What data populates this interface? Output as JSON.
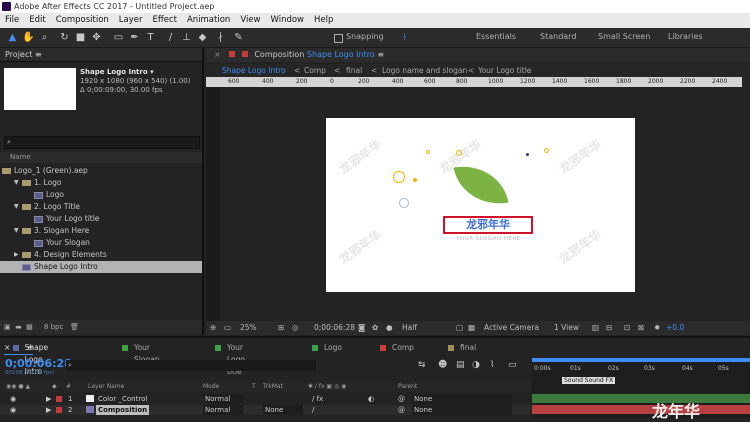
{
  "window": {
    "title": "Adobe After Effects CC 2017 - Untitled Project.aep"
  },
  "menu": [
    "File",
    "Edit",
    "Composition",
    "Layer",
    "Effect",
    "Animation",
    "View",
    "Window",
    "Help"
  ],
  "toolbar": {
    "snapping": "Snapping",
    "workspaces": [
      "Essentials",
      "Standard",
      "Small Screen",
      "Libraries"
    ]
  },
  "project": {
    "panel_title": "Project",
    "item_name": "Shape Logo Intro",
    "item_info1": "1920 x 1080  (960 x 540) (1.00)",
    "item_info2": "Δ 0;00:09:00, 30.00 fps",
    "col_name": "Name",
    "tree": [
      {
        "label": "Logo_1 (Green).aep",
        "indent": 0,
        "kind": "folder",
        "arrow": "▼"
      },
      {
        "label": "1. Logo",
        "indent": 1,
        "kind": "folder",
        "arrow": "▼"
      },
      {
        "label": "Logo",
        "indent": 2,
        "kind": "comp",
        "arrow": ""
      },
      {
        "label": "2. Logo Title",
        "indent": 1,
        "kind": "folder",
        "arrow": "▼"
      },
      {
        "label": "Your Logo title",
        "indent": 2,
        "kind": "comp",
        "arrow": ""
      },
      {
        "label": "3. Slogan Here",
        "indent": 1,
        "kind": "folder",
        "arrow": "▼"
      },
      {
        "label": "Your Slogan",
        "indent": 2,
        "kind": "comp",
        "arrow": ""
      },
      {
        "label": "4. Design Elements",
        "indent": 1,
        "kind": "folder",
        "arrow": "▶"
      },
      {
        "label": "Shape Logo Intro",
        "indent": 1,
        "kind": "comp",
        "arrow": "",
        "selected": true
      }
    ],
    "bpc": "8 bpc"
  },
  "composition": {
    "tab_prefix": "Composition",
    "tab_name": "Shape Logo Intro",
    "crumbs": [
      "Shape Logo Intro",
      "Comp",
      "final",
      "Logo name and slogan",
      "Your Logo title"
    ],
    "ruler": [
      "600",
      "400",
      "200",
      "0",
      "200",
      "400",
      "600",
      "800",
      "1000",
      "1200",
      "1400",
      "1600",
      "1800",
      "2000",
      "2200",
      "2400"
    ],
    "logo_text": "龙邪年华",
    "slogan": "YOUR SLOGAN HERE",
    "watermark": "龙邪年华",
    "zoom": "25%",
    "timecode": "0;00:06:28",
    "resolution": "Half",
    "camera": "Active Camera",
    "views": "1 View",
    "exposure": "+0.0"
  },
  "timeline": {
    "tabs": [
      {
        "label": "Shape Logo Intro",
        "color": "#5e6ba8"
      },
      {
        "label": "Your Slogan",
        "color": "#3fa04a"
      },
      {
        "label": "Your Logo title",
        "color": "#3fa04a"
      },
      {
        "label": "Logo",
        "color": "#3fa04a"
      },
      {
        "label": "Comp",
        "color": "#cc3e3e"
      },
      {
        "label": "final",
        "color": "#a58b5e"
      }
    ],
    "timecode": "0;00:06:28",
    "timecode_sub": "00208 (30.00 fps)",
    "columns": [
      "Layer Name",
      "Mode",
      "T",
      "TrkMat",
      "Parent"
    ],
    "layers": [
      {
        "num": "1",
        "name": "Color _Control",
        "mode": "Normal",
        "trkmat": "",
        "parent": "None",
        "color": "#c23c3c"
      },
      {
        "num": "2",
        "name": "Composition",
        "mode": "Normal",
        "trkmat": "None",
        "parent": "None",
        "color": "#c23c3c"
      }
    ],
    "ruler": [
      "0:00s",
      "01s",
      "02s",
      "03s",
      "04s",
      "05s"
    ],
    "tooltip": "Sound Sound FX",
    "watermark": "龙年华"
  }
}
